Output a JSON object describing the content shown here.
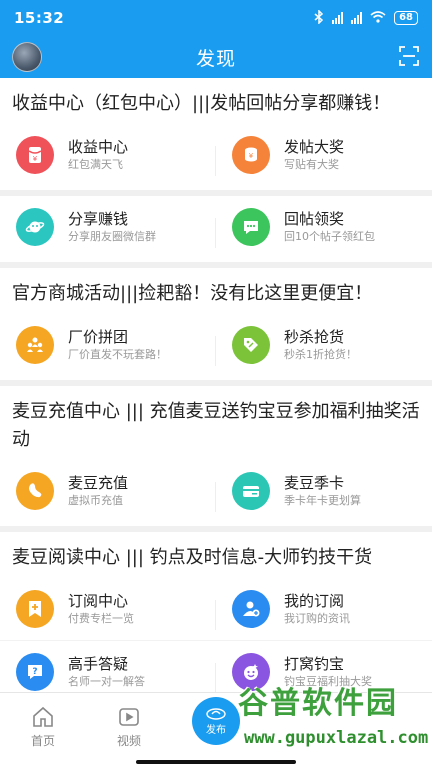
{
  "status": {
    "time": "15:32",
    "battery": "68"
  },
  "nav": {
    "title": "发现"
  },
  "sections": [
    {
      "title": "收益中心（红包中心）|||发帖回帖分享都赚钱！",
      "rows": [
        [
          {
            "title": "收益中心",
            "sub": "红包满天飞",
            "icon": "red-envelope-icon",
            "color": "#f0525a"
          },
          {
            "title": "发帖大奖",
            "sub": "写贴有大奖",
            "icon": "coin-stack-icon",
            "color": "#f5833a"
          }
        ],
        [
          {
            "title": "分享赚钱",
            "sub": "分享朋友圈微信群",
            "icon": "planet-icon",
            "color": "#2cc6c0"
          },
          {
            "title": "回帖领奖",
            "sub": "回10个帖子领红包",
            "icon": "chat-bubble-icon",
            "color": "#3cc55c"
          }
        ]
      ]
    },
    {
      "title": "官方商城活动|||捡耙豁！没有比这里更便宜！",
      "rows": [
        [
          {
            "title": "厂价拼团",
            "sub": "厂价直发不玩套路！",
            "icon": "group-people-icon",
            "color": "#f5a623"
          },
          {
            "title": "秒杀抢货",
            "sub": "秒杀1折抢货！",
            "icon": "price-tag-icon",
            "color": "#7cc33a"
          }
        ]
      ]
    },
    {
      "title": "麦豆充值中心 ||| 充值麦豆送钓宝豆参加福利抽奖活动",
      "rows": [
        [
          {
            "title": "麦豆充值",
            "sub": "虚拟币充值",
            "icon": "bean-icon",
            "color": "#f5a623"
          },
          {
            "title": "麦豆季卡",
            "sub": "季卡年卡更划算",
            "icon": "card-icon",
            "color": "#2cc6b5"
          }
        ]
      ]
    },
    {
      "title": "麦豆阅读中心 ||| 钓点及时信息-大师钓技干货",
      "rows": [
        [
          {
            "title": "订阅中心",
            "sub": "付费专栏一览",
            "icon": "bookmark-plus-icon",
            "color": "#f5a623"
          },
          {
            "title": "我的订阅",
            "sub": "我订购的资讯",
            "icon": "user-add-icon",
            "color": "#2a8cf0"
          }
        ],
        [
          {
            "title": "高手答疑",
            "sub": "名师一对一解答",
            "icon": "question-bubble-icon",
            "color": "#2a8cf0"
          },
          {
            "title": "打窝钓宝",
            "sub": "钓宝豆福利抽大奖",
            "icon": "smile-face-icon",
            "color": "#8a55e0"
          }
        ]
      ]
    }
  ],
  "tabs": {
    "home": "首页",
    "video": "视频",
    "publish": "发布"
  },
  "watermark": {
    "name": "谷普软件园",
    "url": "www.gupuxlazal.com"
  }
}
